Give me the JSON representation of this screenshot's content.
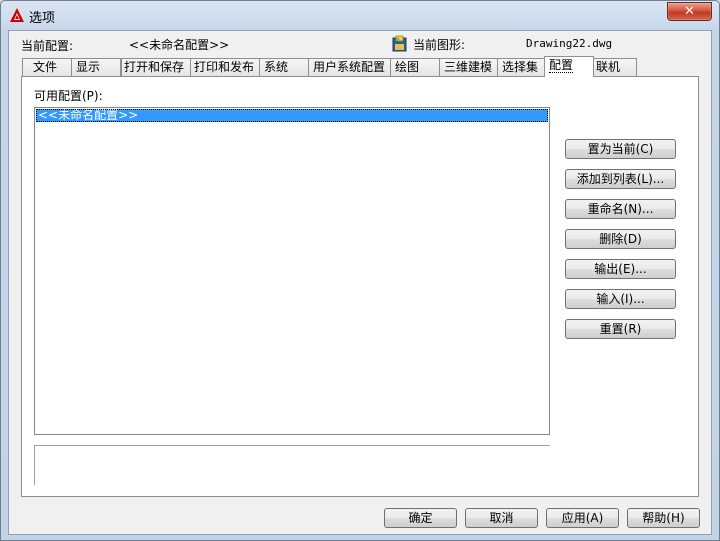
{
  "window": {
    "title": "选项",
    "close_label": "✕"
  },
  "header": {
    "current_profile_label": "当前配置:",
    "current_profile_value": "<<未命名配置>>",
    "current_drawing_label": "当前图形:",
    "current_drawing_value": "Drawing22.dwg"
  },
  "tabs": [
    {
      "label": "文件"
    },
    {
      "label": "显示"
    },
    {
      "label": "打开和保存"
    },
    {
      "label": "打印和发布"
    },
    {
      "label": "系统"
    },
    {
      "label": "用户系统配置"
    },
    {
      "label": "绘图"
    },
    {
      "label": "三维建模"
    },
    {
      "label": "选择集"
    },
    {
      "label": "配置",
      "active": true
    },
    {
      "label": "联机"
    }
  ],
  "profiles": {
    "list_label": "可用配置(P):",
    "items": [
      "<<未命名配置>>"
    ],
    "selected_index": 0
  },
  "side_buttons": {
    "set_current": "置为当前(C)",
    "add_to_list": "添加到列表(L)...",
    "rename": "重命名(N)...",
    "delete": "删除(D)",
    "export": "输出(E)...",
    "import": "输入(I)...",
    "reset": "重置(R)"
  },
  "footer": {
    "ok": "确定",
    "cancel": "取消",
    "apply": "应用(A)",
    "help": "帮助(H)"
  },
  "colors": {
    "selection": "#3399ff",
    "close_button": "#c8452b",
    "app_icon": "#cc0000"
  }
}
